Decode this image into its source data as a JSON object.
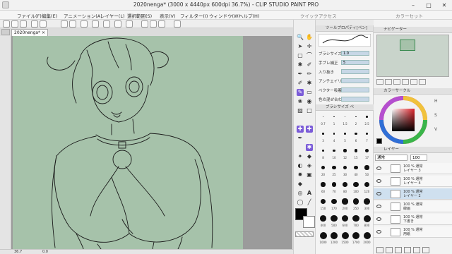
{
  "window": {
    "title": "2020nenga* (3000 x 4440px 600dpi 36.7%) - CLIP STUDIO PAINT PRO",
    "minimize": "–",
    "maximize": "□",
    "close": "✕",
    "quick_access_label": "クイックアクセス",
    "color_set_label": "カラーセット"
  },
  "menu": [
    "ファイル(F)",
    "編集(E)",
    "アニメーション(A)",
    "レイヤー(L)",
    "選択範囲(S)",
    "表示(V)",
    "フィルター(I)",
    "ウィンドウ(W)",
    "ヘルプ(H)"
  ],
  "document_tab": {
    "label": "2020nenga*",
    "close": "×"
  },
  "subtool_panel": {
    "header": "ツールプロパティ[ペン]",
    "rows": [
      {
        "label": "ブラシサイズ",
        "value": "1.0"
      },
      {
        "label": "手ブレ補正",
        "value": "5"
      },
      {
        "label": "入り抜き",
        "value": ""
      },
      {
        "label": "アンチエイリアス",
        "value": ""
      },
      {
        "label": "ベクター吸着",
        "value": ""
      },
      {
        "label": "色の混ぜ合わせ",
        "value": ""
      }
    ],
    "brush_size_header": "ブラシサイズ ペ",
    "brush_sizes": [
      "0.7",
      "1",
      "1.5",
      "2",
      "2.5",
      "3",
      "4",
      "5",
      "6",
      "7",
      "8",
      "10",
      "12",
      "15",
      "17",
      "20",
      "25",
      "30",
      "40",
      "50",
      "60",
      "70",
      "80",
      "100",
      "120",
      "150",
      "170",
      "200",
      "250",
      "300",
      "400",
      "500",
      "600",
      "700",
      "800",
      "1000",
      "1200",
      "1500",
      "1700",
      "2000"
    ]
  },
  "right_panel": {
    "navigator_header": "ナビゲーター",
    "color_header": "カラーサークル",
    "layer_header": "レイヤー",
    "blend_mode": "通常",
    "opacity": "100",
    "layers": [
      {
        "name": "100 % 通常\nレイヤー 3",
        "selected": false
      },
      {
        "name": "100 % 通常\nレイヤー 4",
        "selected": false
      },
      {
        "name": "100 % 通常\nレイヤー 2",
        "selected": true
      },
      {
        "name": "100 % 通常\n線画",
        "selected": false
      },
      {
        "name": "100 % 通常\n下書き",
        "selected": false
      },
      {
        "name": "100 % 通常\n用紙",
        "selected": false
      }
    ]
  },
  "status": {
    "zoom": "36.7",
    "angle": "0.0"
  },
  "colors": {
    "accent": "#7a5bd8",
    "canvas_bg": "#a6c2aa",
    "selection": "#cfe0ef"
  }
}
